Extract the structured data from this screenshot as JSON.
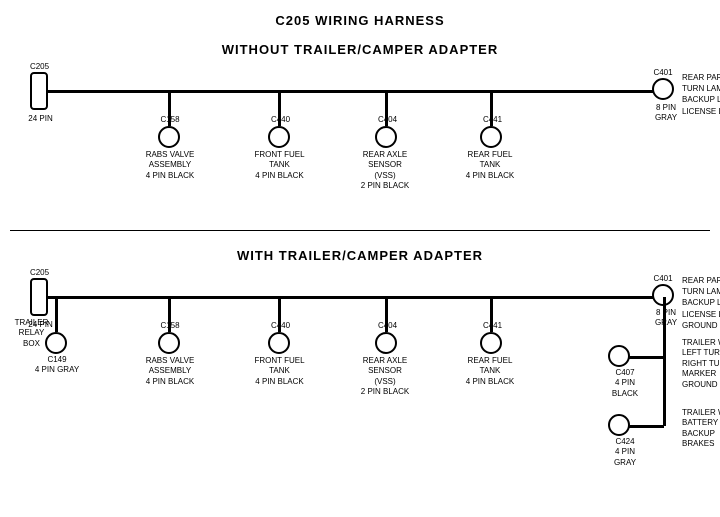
{
  "title": "C205 WIRING HARNESS",
  "top_section": {
    "label": "WITHOUT  TRAILER/CAMPER  ADAPTER",
    "left_connector": {
      "id": "C205-top",
      "label_top": "C205",
      "label_bottom": "24 PIN"
    },
    "right_connector": {
      "id": "C401-top",
      "label_top": "C401",
      "label_right": "REAR PARK/STOP\nTURN LAMPS\nBACKUP LAMPS\nLICENSE LAMPS",
      "label_bottom": "8 PIN\nGRAY"
    },
    "connectors": [
      {
        "id": "C158-top",
        "label_top": "C158",
        "label_bottom": "RABS VALVE\nASSEMBLY\n4 PIN BLACK"
      },
      {
        "id": "C440-top",
        "label_top": "C440",
        "label_bottom": "FRONT FUEL\nTANK\n4 PIN BLACK"
      },
      {
        "id": "C404-top",
        "label_top": "C404",
        "label_bottom": "REAR AXLE\nSENSOR\n(VSS)\n2 PIN BLACK"
      },
      {
        "id": "C441-top",
        "label_top": "C441",
        "label_bottom": "REAR FUEL\nTANK\n4 PIN BLACK"
      }
    ]
  },
  "bottom_section": {
    "label": "WITH  TRAILER/CAMPER  ADAPTER",
    "left_connector": {
      "id": "C205-bot",
      "label_top": "C205",
      "label_bottom": "24 PIN"
    },
    "right_connector": {
      "id": "C401-bot",
      "label_top": "C401",
      "label_right": "REAR PARK/STOP\nTURN LAMPS\nBACKUP LAMPS\nLICENSE LAMPS\nGROUND",
      "label_bottom": "8 PIN\nGRAY"
    },
    "connectors": [
      {
        "id": "C158-bot",
        "label_top": "C158",
        "label_bottom": "RABS VALVE\nASSEMBLY\n4 PIN BLACK"
      },
      {
        "id": "C440-bot",
        "label_top": "C440",
        "label_bottom": "FRONT FUEL\nTANK\n4 PIN BLACK"
      },
      {
        "id": "C404-bot",
        "label_top": "C404",
        "label_bottom": "REAR AXLE\nSENSOR\n(VSS)\n2 PIN BLACK"
      },
      {
        "id": "C441-bot",
        "label_top": "C441",
        "label_bottom": "REAR FUEL\nTANK\n4 PIN BLACK"
      }
    ],
    "extra_left": {
      "label1": "TRAILER\nRELAY\nBOX",
      "id": "C149",
      "label2": "C149\n4 PIN GRAY"
    },
    "extra_right": [
      {
        "id": "C407",
        "label_top": "TRAILER WIRES\nLEFT TURN\nRIGHT TURN\nMARKER\nGROUND",
        "label_bottom": "C407\n4 PIN\nBLACK"
      },
      {
        "id": "C424",
        "label_top": "TRAILER WIRES\nBATTERY CHARGE\nBACKUP\nBRAKES",
        "label_bottom": "C424\n4 PIN\nGRAY"
      }
    ]
  }
}
